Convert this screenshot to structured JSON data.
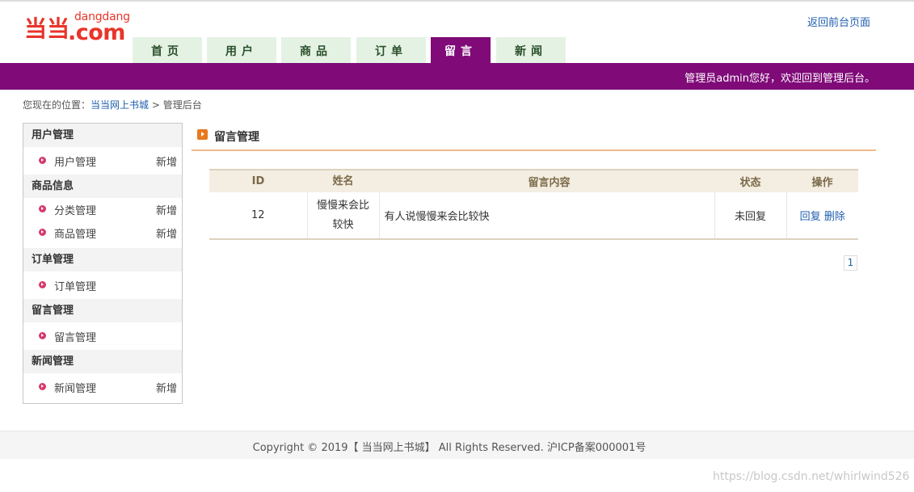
{
  "brand": {
    "logo_small": "dangdang",
    "logo_big": ".com",
    "logo_mark": "当当"
  },
  "header": {
    "back_link": "返回前台页面",
    "welcome": "管理员admin您好，欢迎回到管理后台。"
  },
  "nav": {
    "tabs": [
      "首页",
      "用户",
      "商品",
      "订单",
      "留言",
      "新闻"
    ],
    "active": "留言"
  },
  "breadcrumb": {
    "prefix": "您现在的位置：",
    "home": "当当网上书城",
    "sep": ">",
    "current": "管理后台"
  },
  "sidebar": {
    "groups": [
      {
        "title": "用户管理",
        "items": [
          {
            "label": "用户管理",
            "add": "新增"
          }
        ]
      },
      {
        "title": "商品信息",
        "items": [
          {
            "label": "分类管理",
            "add": "新增"
          },
          {
            "label": "商品管理",
            "add": "新增"
          }
        ]
      },
      {
        "title": "订单管理",
        "items": [
          {
            "label": "订单管理",
            "add": ""
          }
        ]
      },
      {
        "title": "留言管理",
        "items": [
          {
            "label": "留言管理",
            "add": ""
          }
        ]
      },
      {
        "title": "新闻管理",
        "items": [
          {
            "label": "新闻管理",
            "add": "新增"
          }
        ]
      }
    ]
  },
  "main": {
    "title": "留言管理",
    "table": {
      "headers": [
        "ID",
        "姓名",
        "留言内容",
        "状态",
        "操作"
      ],
      "rows": [
        {
          "id": "12",
          "name": "慢慢来会比较快",
          "content": "有人说慢慢来会比较快",
          "status": "未回复",
          "reply": "回复",
          "delete": "删除"
        }
      ]
    },
    "pager": {
      "page": "1"
    }
  },
  "footer": {
    "copyright": "Copyright © 2019【 当当网上书城】 All Rights Reserved. 沪ICP备案000001号"
  },
  "watermark": "https://blog.csdn.net/whirlwind526",
  "colors": {
    "accent": "#7f0a78",
    "tab_bg": "#e4f2e4",
    "logo": "#e8352a",
    "link": "#1f5fae"
  }
}
